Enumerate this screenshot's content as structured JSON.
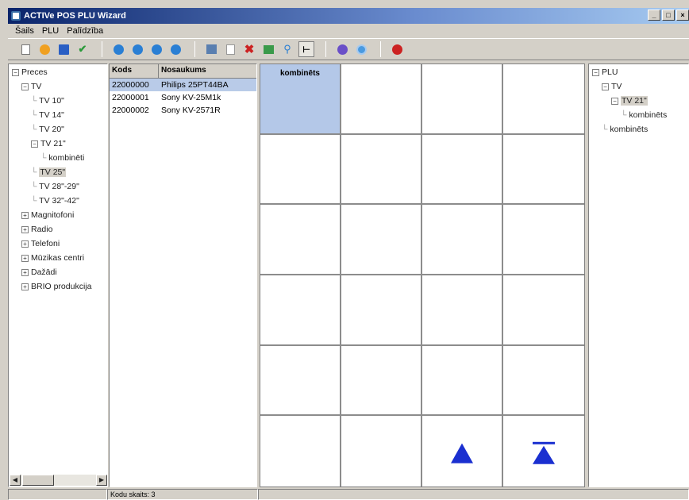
{
  "window": {
    "title": "ACTIVe POS PLU Wizard",
    "controls": [
      "_",
      "□",
      "×"
    ]
  },
  "menu": [
    {
      "label": "Šails"
    },
    {
      "label": "PLU"
    },
    {
      "label": "Palīdzība"
    }
  ],
  "toolbar": {
    "colors": {
      "blue": "#2a7fd4",
      "red": "#cc2222",
      "green": "#2a9a3a",
      "orange": "#f0a020",
      "purple": "#6a4fc8"
    }
  },
  "left_tree": [
    {
      "label": "Preces",
      "exp": "−",
      "indent": 0
    },
    {
      "label": "TV",
      "exp": "−",
      "indent": 1
    },
    {
      "label": "TV 10\"",
      "exp": "",
      "indent": 2
    },
    {
      "label": "TV 14\"",
      "exp": "",
      "indent": 2
    },
    {
      "label": "TV 20\"",
      "exp": "",
      "indent": 2
    },
    {
      "label": "TV 21\"",
      "exp": "−",
      "indent": 2
    },
    {
      "label": "kombinēti",
      "exp": "",
      "indent": 3
    },
    {
      "label": "TV 25\"",
      "exp": "",
      "indent": 2,
      "selected": true
    },
    {
      "label": "TV 28\"-29\"",
      "exp": "",
      "indent": 2
    },
    {
      "label": "TV 32\"-42\"",
      "exp": "",
      "indent": 2
    },
    {
      "label": "Magnitofoni",
      "exp": "+",
      "indent": 1
    },
    {
      "label": "Radio",
      "exp": "+",
      "indent": 1
    },
    {
      "label": "Telefoni",
      "exp": "+",
      "indent": 1
    },
    {
      "label": "Mūzikas centri",
      "exp": "+",
      "indent": 1
    },
    {
      "label": "Dažādi",
      "exp": "+",
      "indent": 1
    },
    {
      "label": "BRIO produkcija",
      "exp": "+",
      "indent": 1
    }
  ],
  "product_list": {
    "columns": [
      "Kods",
      "Nosaukums"
    ],
    "rows": [
      {
        "code": "22000000",
        "name": "Philips 25PT44BA",
        "selected": true
      },
      {
        "code": "22000001",
        "name": "Sony KV-25M1k"
      },
      {
        "code": "22000002",
        "name": "Sony KV-2571R"
      }
    ]
  },
  "plu_grid": {
    "cells": [
      {
        "label": "kombinēts",
        "filled": true
      },
      {
        "label": ""
      },
      {
        "label": ""
      },
      {
        "label": ""
      },
      {
        "label": ""
      },
      {
        "label": ""
      },
      {
        "label": ""
      },
      {
        "label": ""
      },
      {
        "label": ""
      },
      {
        "label": ""
      },
      {
        "label": ""
      },
      {
        "label": ""
      },
      {
        "label": ""
      },
      {
        "label": ""
      },
      {
        "label": ""
      },
      {
        "label": ""
      },
      {
        "label": ""
      },
      {
        "label": ""
      },
      {
        "label": ""
      },
      {
        "label": ""
      },
      {
        "label": ""
      },
      {
        "label": ""
      },
      {
        "label": "",
        "icon": "arrow-up-icon"
      },
      {
        "label": "",
        "icon": "arrow-top-icon"
      }
    ],
    "arrow_color": "#1a2fd0"
  },
  "right_tree": [
    {
      "label": "PLU",
      "exp": "−",
      "indent": 0
    },
    {
      "label": "TV",
      "exp": "−",
      "indent": 1
    },
    {
      "label": "TV 21\"",
      "exp": "−",
      "indent": 2,
      "selected": true
    },
    {
      "label": "kombinēts",
      "exp": "",
      "indent": 3
    },
    {
      "label": "kombinēts",
      "exp": "",
      "indent": 1
    }
  ],
  "status": {
    "count_text": "Kodu skaits: 3"
  }
}
